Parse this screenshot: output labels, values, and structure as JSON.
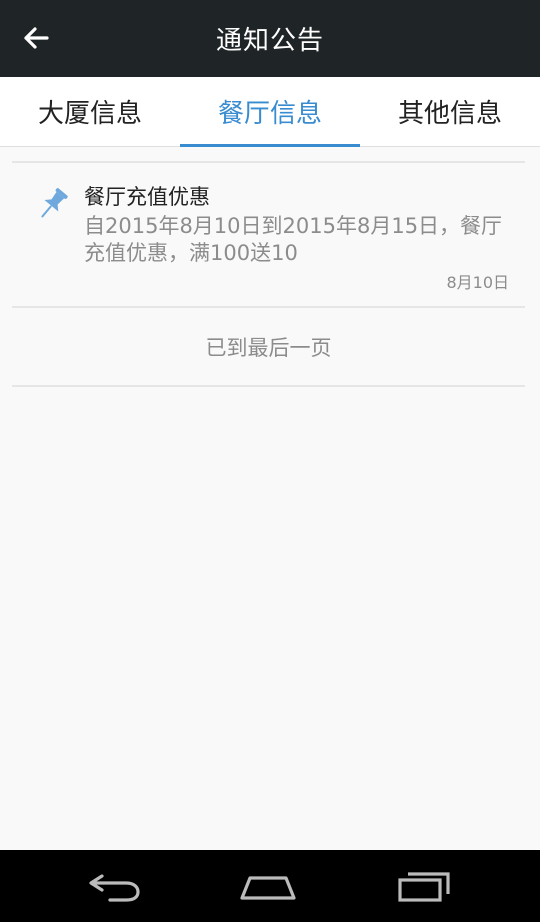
{
  "header": {
    "title": "通知公告",
    "back_icon": "arrow-left-icon"
  },
  "tabs": [
    {
      "label": "大厦信息",
      "active": false
    },
    {
      "label": "餐厅信息",
      "active": true
    },
    {
      "label": "其他信息",
      "active": false
    }
  ],
  "notices": [
    {
      "icon": "pin-icon",
      "title": "餐厅充值优惠",
      "body": "自2015年8月10日到2015年8月15日，餐厅充值优惠，满100送10",
      "date": "8月10日"
    }
  ],
  "list_end_text": "已到最后一页",
  "colors": {
    "accent": "#3a8cd0",
    "app_bar": "#1f2426",
    "pin": "#6fa8dc"
  },
  "nav_bar": {
    "icons": [
      "back-icon",
      "home-icon",
      "recent-apps-icon"
    ]
  }
}
